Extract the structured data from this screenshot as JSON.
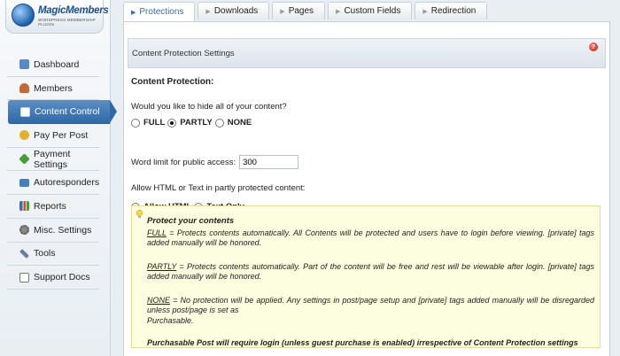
{
  "brand": {
    "name": "MagicMembers",
    "tagline": "WORDPRESS MEMBERSHIP PLUGIN"
  },
  "sidebar": {
    "items": [
      {
        "label": "Dashboard",
        "icon": "dashboard-icon",
        "color": "#5a88c4"
      },
      {
        "label": "Members",
        "icon": "members-icon",
        "color": "#c06a3a"
      },
      {
        "label": "Content Control",
        "icon": "document-icon",
        "color": "#ffffff",
        "active": true
      },
      {
        "label": "Pay Per Post",
        "icon": "coin-icon",
        "color": "#e0b030"
      },
      {
        "label": "Payment Settings",
        "icon": "payment-icon",
        "color": "#4c9a3a"
      },
      {
        "label": "Autoresponders",
        "icon": "mail-icon",
        "color": "#4a7fb5"
      },
      {
        "label": "Reports",
        "icon": "chart-icon",
        "color": "#3a6ea5"
      },
      {
        "label": "Misc. Settings",
        "icon": "gear-icon",
        "color": "#888888"
      },
      {
        "label": "Tools",
        "icon": "wrench-icon",
        "color": "#6a7fa0"
      },
      {
        "label": "Support Docs",
        "icon": "docs-icon",
        "color": "#777777"
      }
    ]
  },
  "tabs": [
    {
      "label": "Protections",
      "active": true
    },
    {
      "label": "Downloads"
    },
    {
      "label": "Pages"
    },
    {
      "label": "Custom Fields"
    },
    {
      "label": "Redirection"
    }
  ],
  "section": {
    "title": "Content Protection Settings",
    "help": "?"
  },
  "form": {
    "heading": "Content Protection:",
    "hide_question": "Would you like to hide all of your content?",
    "hide_options": [
      {
        "label": "FULL",
        "checked": false
      },
      {
        "label": "PARTLY",
        "checked": true
      },
      {
        "label": "NONE",
        "checked": false
      }
    ],
    "word_limit_label": "Word limit for public access:",
    "word_limit_value": "300",
    "html_question": "Allow HTML or Text in partly protected content:",
    "html_options": [
      {
        "label": "Allow HTML",
        "checked": true
      },
      {
        "label": "Text Only",
        "checked": false
      }
    ]
  },
  "info": {
    "title": "Protect your contents",
    "full_term": "FULL",
    "full_text": " = Protects contents automatically. All Contents will be protected and users have to login before viewing. [private] tags added manually will be honored.",
    "partly_term": "PARTLY",
    "partly_text": " = Protects contents automatically. Part of the content will be free and rest will be viewable after login. [private] tags added manually will be honored.",
    "none_term": "NONE",
    "none_text": " = No protection will be applied. Any settings in post/page setup and [private] tags added manually will be disregarded unless post/page is set as",
    "none_text2": "Purchasable.",
    "final": "Purchasable Post will require login (unless guest purchase is enabled) irrespective of Content Protection settings"
  }
}
